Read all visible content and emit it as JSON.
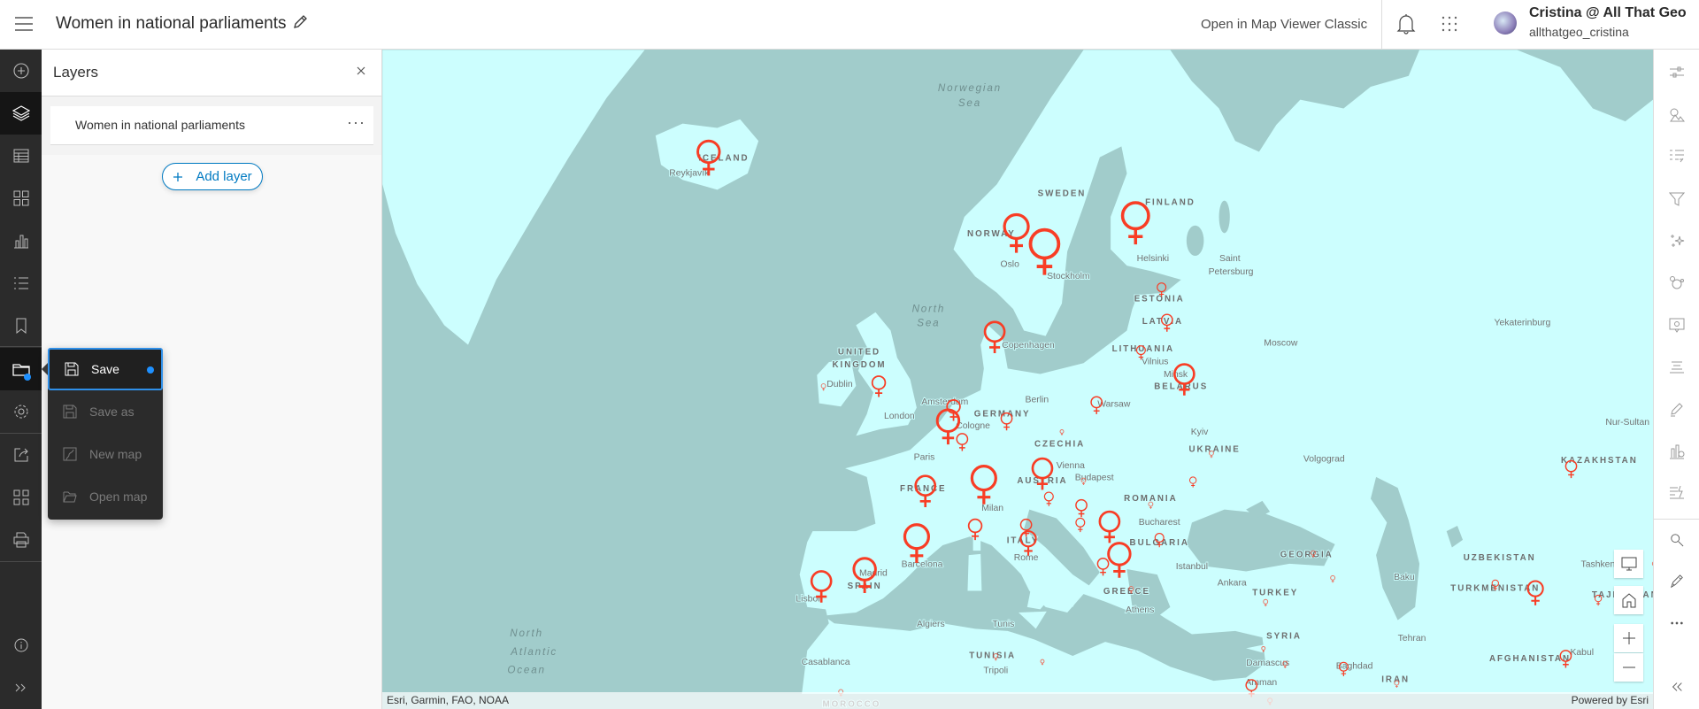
{
  "header": {
    "title": "Women in national parliaments",
    "open_classic": "Open in Map Viewer Classic",
    "user_name": "Cristina @ All That Geo",
    "user_login": "allthatgeo_cristina"
  },
  "layers_panel": {
    "title": "Layers",
    "layers": [
      {
        "name": "Women in national parliaments"
      }
    ],
    "add_layer": "Add layer"
  },
  "save_menu": {
    "items": [
      {
        "label": "Save",
        "icon": "save-icon",
        "selected": true,
        "unsaved_indicator": true
      },
      {
        "label": "Save as",
        "icon": "save-as-icon"
      },
      {
        "label": "New map",
        "icon": "new-map-icon"
      },
      {
        "label": "Open map",
        "icon": "folder-open-icon"
      }
    ]
  },
  "left_toolbar": [
    "add-icon",
    "layers-icon",
    "table-icon",
    "basemap-icon",
    "charts-icon",
    "legend-icon",
    "bookmark-icon",
    "save-folder-icon",
    "settings-icon",
    "share-icon",
    "apps-icon",
    "print-icon",
    "info-icon",
    "expand-icon"
  ],
  "right_toolbar": [
    "properties-icon",
    "styles-icon",
    "fields-icon",
    "filter-icon",
    "effects-icon",
    "clustering-icon",
    "popups-icon",
    "labels-icon",
    "sketch-icon",
    "configure-icon",
    "forms-icon",
    "search-icon",
    "measure-icon",
    "more-icon",
    "collapse-icon"
  ],
  "map": {
    "country_labels": [
      "ICELAND",
      "SWEDEN",
      "NORWAY",
      "FINLAND",
      "ESTONIA",
      "LATVIA",
      "LITHUANIA",
      "BELARUS",
      "UNITED",
      "KINGDOM",
      "GERMANY",
      "CZECHIA",
      "AUSTRIA",
      "FRANCE",
      "SPAIN",
      "ITALY",
      "ROMANIA",
      "BULGARIA",
      "GREECE",
      "UKRAINE",
      "TURKEY",
      "GEORGIA",
      "KAZAKHSTAN",
      "UZBEKISTAN",
      "TURKMENISTAN",
      "TAJIKISTAN",
      "AFGHANISTAN",
      "SYRIA",
      "IRAN",
      "TUNISIA",
      "MOROCCO"
    ],
    "city_labels": [
      "Reykjavík",
      "Oslo",
      "Stockholm",
      "Helsinki",
      "Saint",
      "Petersburg",
      "Copenhagen",
      "Vilnius",
      "Minsk",
      "Moscow",
      "Yekaterinburg",
      "Dublin",
      "London",
      "Amsterdam",
      "Cologne",
      "Berlin",
      "Warsaw",
      "Paris",
      "Vienna",
      "Budapest",
      "Milan",
      "Kyiv",
      "Volgograd",
      "Nur-Sultan",
      "Bucharest",
      "Barcelona",
      "Madrid",
      "Lisbon",
      "Rome",
      "Istanbul",
      "Ankara",
      "Baku",
      "Tashkent",
      "Athens",
      "Algiers",
      "Tunis",
      "Casablanca",
      "Tripoli",
      "Tehran",
      "Damascus",
      "Baghdad",
      "Amman",
      "Kabul"
    ],
    "sea_labels": [
      "Norwegian",
      "Sea",
      "North",
      "Sea",
      "North",
      "Atlantic",
      "Ocean"
    ],
    "attribution": "Esri, Garmin, FAO, NOAA",
    "powered_by": "Powered by Esri",
    "colors": {
      "water": "#a1cccb",
      "land": "#ccfefe",
      "symbol": "#f83d25"
    },
    "widgets": [
      "monitor-icon",
      "home-icon",
      "zoom-in-icon",
      "zoom-out-icon"
    ]
  }
}
